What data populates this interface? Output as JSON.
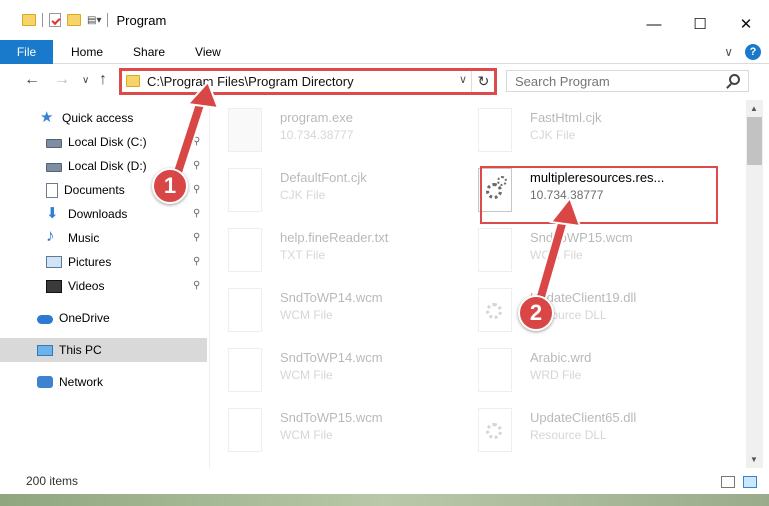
{
  "window": {
    "title": "Program",
    "controls": {
      "minimize": "—",
      "maximize": "☐",
      "close": "✕"
    }
  },
  "ribbon": {
    "tabs": [
      "File",
      "Home",
      "Share",
      "View"
    ],
    "expand_icon": "∨",
    "help_icon": "?"
  },
  "navigation": {
    "back_icon": "←",
    "forward_icon": "→",
    "recent_icon": "∨",
    "up_icon": "↑",
    "address": "C:\\Program Files\\Program Directory",
    "address_dropdown_icon": "∨",
    "refresh_icon": "↻",
    "search_placeholder": "Search Program"
  },
  "sidebar": {
    "items": [
      {
        "label": "Quick access",
        "icon": "star-icon",
        "pinned": false
      },
      {
        "label": "Local Disk (C:)",
        "icon": "disk-icon",
        "pinned": true
      },
      {
        "label": "Local Disk (D:)",
        "icon": "disk-icon",
        "pinned": true
      },
      {
        "label": "Documents",
        "icon": "documents-icon",
        "pinned": true
      },
      {
        "label": "Downloads",
        "icon": "download-icon",
        "pinned": true
      },
      {
        "label": "Music",
        "icon": "music-icon",
        "pinned": true
      },
      {
        "label": "Pictures",
        "icon": "pictures-icon",
        "pinned": true
      },
      {
        "label": "Videos",
        "icon": "videos-icon",
        "pinned": true
      },
      {
        "label": "OneDrive",
        "icon": "cloud-icon",
        "pinned": false
      },
      {
        "label": "This PC",
        "icon": "computer-icon",
        "pinned": false,
        "selected": true
      },
      {
        "label": "Network",
        "icon": "network-icon",
        "pinned": false
      }
    ]
  },
  "files": [
    {
      "name": "program.exe",
      "detail": "10.734.38777",
      "type": "exe",
      "faded": true
    },
    {
      "name": "FastHtml.cjk",
      "detail": "CJK File",
      "type": "doc",
      "faded": true
    },
    {
      "name": "DefaultFont.cjk",
      "detail": "CJK File",
      "type": "doc",
      "faded": true
    },
    {
      "name": "multipleresources.res...",
      "detail": "10.734.38777",
      "type": "dll",
      "faded": false
    },
    {
      "name": "help.fineReader.txt",
      "detail": "TXT File",
      "type": "doc",
      "faded": true
    },
    {
      "name": "SndToWP15.wcm",
      "detail": "WCM File",
      "type": "doc",
      "faded": true
    },
    {
      "name": "SndToWP14.wcm",
      "detail": "WCM File",
      "type": "doc",
      "faded": true
    },
    {
      "name": "UpdateClient19.dll",
      "detail": "Resource DLL",
      "type": "dll",
      "faded": true
    },
    {
      "name": "SndToWP14.wcm",
      "detail": "WCM File",
      "type": "doc",
      "faded": true
    },
    {
      "name": "Arabic.wrd",
      "detail": "WRD File",
      "type": "doc",
      "faded": true
    },
    {
      "name": "SndToWP15.wcm",
      "detail": "WCM File",
      "type": "doc",
      "faded": true
    },
    {
      "name": "UpdateClient65.dll",
      "detail": "Resource DLL",
      "type": "dll",
      "faded": true
    }
  ],
  "status": {
    "item_count": "200 items"
  },
  "annotations": {
    "callout_1": "1",
    "callout_2": "2"
  },
  "colors": {
    "accent": "#1979ca",
    "highlight": "#dc4a4a",
    "callout": "#d94646"
  }
}
